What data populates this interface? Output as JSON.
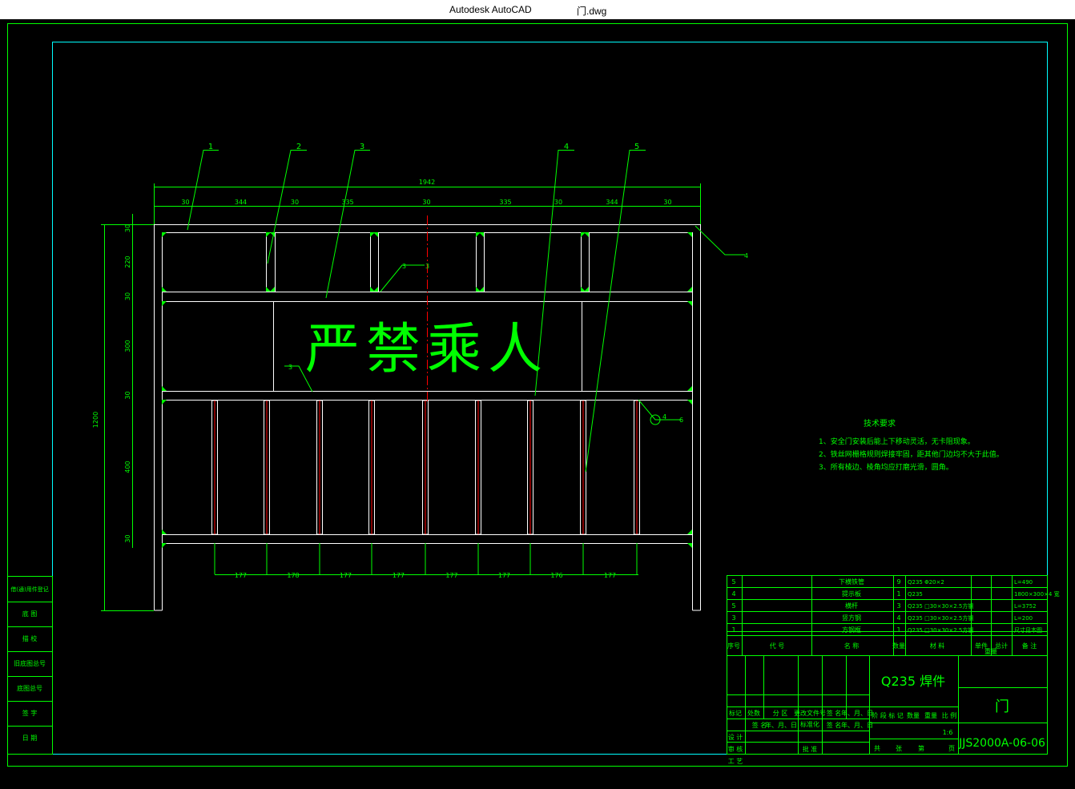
{
  "window": {
    "app_title": "Autodesk AutoCAD",
    "file_name": "门.dwg"
  },
  "colors": {
    "background": "#000000",
    "line": "#00ff00",
    "dim": "#00ff00",
    "border": "#00ff00",
    "inner_border": "#00ffff",
    "frame": "#ffffff",
    "center": "#ff0000"
  },
  "drawing": {
    "slogan": "严禁乘人",
    "overall_width": "1942",
    "overall_height": "1200",
    "top_dims": [
      "30",
      "344",
      "30",
      "335",
      "30",
      "335",
      "30",
      "344",
      "30"
    ],
    "bottom_dims": [
      "177",
      "178",
      "177",
      "177",
      "177",
      "177",
      "176",
      "177"
    ],
    "left_dims": [
      "30",
      "220",
      "30",
      "300",
      "30",
      "400",
      "30"
    ],
    "callouts": [
      "1",
      "2",
      "3",
      "4",
      "5"
    ],
    "weld_marks": [
      "4",
      "3",
      "3",
      "4",
      "6",
      "3"
    ]
  },
  "tech_req": {
    "title": "技术要求",
    "lines": [
      "1、安全门安装后能上下移动灵活，无卡阻现象。",
      "2、铁丝网栅格规则焊接牢固，距其他门边均不大于此值。",
      "3、所有棱边、棱角均应打磨光滑，圆角。"
    ]
  },
  "bom": {
    "rows": [
      {
        "no": "5",
        "name": "下横铁管",
        "qty": "9",
        "spec": "Q235  Φ20×2",
        "note": "L=490"
      },
      {
        "no": "4",
        "name": "提示板",
        "qty": "1",
        "spec": "Q235",
        "note": "1800×300×4 宽"
      },
      {
        "no": "5",
        "name": "横杆",
        "qty": "3",
        "spec": "Q235  □30×30×2.5方钢",
        "note": "L=3752"
      },
      {
        "no": "3",
        "name": "竖方钢",
        "qty": "4",
        "spec": "Q235  □30×30×2.5方钢",
        "note": "L=200"
      },
      {
        "no": "1",
        "name": "方钢框",
        "qty": "1",
        "spec": "Q235  □30×30×2.5方钢",
        "note": "尺寸见本图"
      }
    ],
    "header": [
      "序号",
      "代  号",
      "名  称",
      "数量",
      "材  料",
      "单件",
      "总计",
      "备  注"
    ],
    "weight_label": "重量"
  },
  "title_block": {
    "material": "Q235 焊件",
    "part_name": "门",
    "drawing_no": "JJS2000A-06-06",
    "scale": "1:6",
    "labels_row1": [
      "标记",
      "处数",
      "分 区",
      "更改文件号",
      "签 名",
      "年、月、日"
    ],
    "labels_row2": [
      "签 名",
      "年、月、日",
      "签 名",
      "年、月、日"
    ],
    "stage_labels": [
      "阶 段 标 记",
      "数量",
      "重量",
      "比 例"
    ],
    "people": [
      "设 计",
      "审 核",
      "工 艺"
    ],
    "standard": "标准化",
    "approve": "批 准",
    "sheet": [
      "共",
      "张",
      "第",
      "页"
    ]
  },
  "left_strip": [
    "借(通)用件登记",
    "底 图",
    "描 校",
    "旧底图总号",
    "底图总号",
    "签 字",
    "日 期"
  ]
}
